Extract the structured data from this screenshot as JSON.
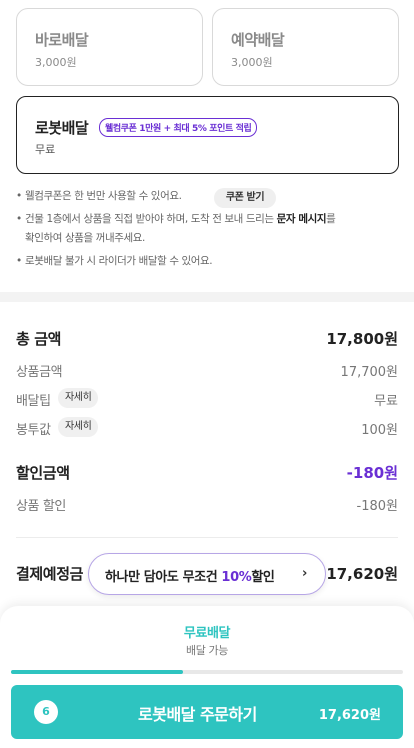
{
  "delivery_options": {
    "direct": {
      "title": "바로배달",
      "price": "3,000원"
    },
    "reserve": {
      "title": "예약배달",
      "price": "3,000원"
    },
    "robot": {
      "title": "로봇배달",
      "promo": "웰컴쿠폰 1만원 + 최대 5% 포인트 적립",
      "price": "무료"
    }
  },
  "notices": {
    "bullet": "•",
    "welcome_coupon": "웰컴쿠폰은 한 번만 사용할 수 있어요.",
    "coupon_button": "쿠폰 받기",
    "building_line1_a": "건물 1층에서 상품을 직접 받아야 하며, 도착 전 보내 드리는 ",
    "building_line1_b": "문자 메시지",
    "building_line1_c": "를",
    "building_line2": "확인하여 상품을 꺼내주세요.",
    "robot_unavailable": "로봇배달 불가 시 라이더가 배달할 수 있어요."
  },
  "summary": {
    "total_label": "총 금액",
    "total_value": "17,800원",
    "product_label": "상품금액",
    "product_value": "17,700원",
    "tip_label": "배달팁",
    "tip_detail": "자세히",
    "tip_value": "무료",
    "bag_label": "봉투값",
    "bag_detail": "자세히",
    "bag_value": "100원",
    "discount_label": "할인금액",
    "discount_value": "-180원",
    "product_discount_label": "상품 할인",
    "product_discount_value": "-180원",
    "expected_label": "결제예정금",
    "expected_value": "17,620원"
  },
  "promo_banner": {
    "text_before": "하나만 담아도 무조건 ",
    "percent": "10%",
    "text_after": "할인",
    "chevron": "›"
  },
  "bottom": {
    "free_delivery_title": "무료배달",
    "free_delivery_sub": "배달 가능",
    "progress": 0.44,
    "item_count": "6",
    "order_label": "로봇배달 주문하기",
    "order_amount": "17,620원"
  },
  "colors": {
    "accent_teal": "#2ec4c0",
    "accent_purple": "#6a2fd4"
  }
}
